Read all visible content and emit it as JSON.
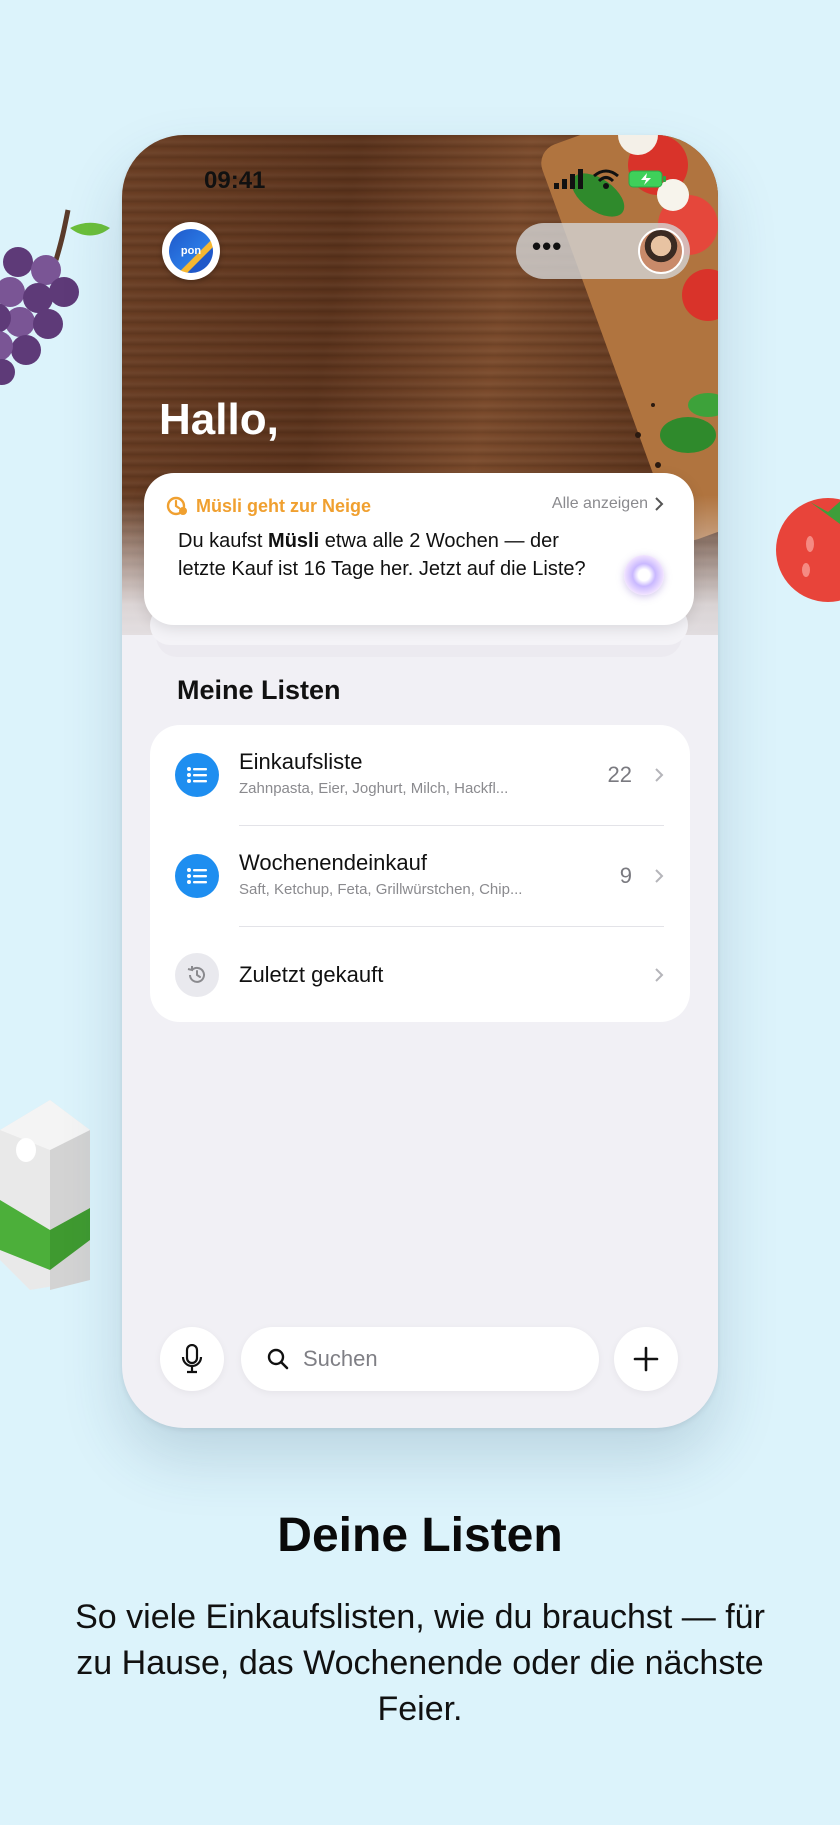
{
  "status_bar": {
    "time": "09:41"
  },
  "header": {
    "greeting": "Hallo,",
    "logo_text": "pon"
  },
  "suggestion": {
    "title": "Müsli geht zur Neige",
    "see_all": "Alle anzeigen",
    "text_before": "Du kaufst ",
    "text_bold": "Müsli",
    "text_after": " etwa alle 2 Wochen — der letzte Kauf ist 16 Tage her. Jetzt auf die Liste?"
  },
  "lists": {
    "title": "Meine Listen",
    "items": [
      {
        "name": "Einkaufsliste",
        "preview": "Zahnpasta, Eier, Joghurt, Milch, Hackfl...",
        "count": "22"
      },
      {
        "name": "Wochenendeinkauf",
        "preview": "Saft, Ketchup, Feta, Grillwürstchen, Chip...",
        "count": "9"
      },
      {
        "name": "Zuletzt gekauft"
      }
    ]
  },
  "search": {
    "placeholder": "Suchen"
  },
  "marketing": {
    "headline": "Deine Listen",
    "subline": "So viele Einkaufslisten, wie du brauchst — für zu Hause, das Wochenende oder die nächste Feier."
  },
  "colors": {
    "accent_blue": "#1e8ef0",
    "warning_orange": "#f0a030",
    "background": "#dcf3fb"
  }
}
